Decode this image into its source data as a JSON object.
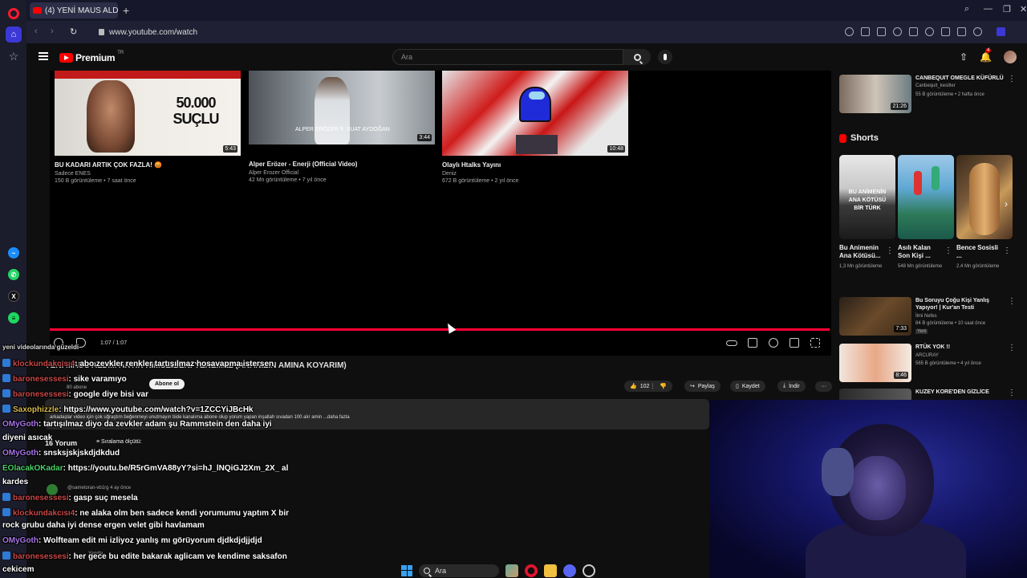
{
  "browser": {
    "tab_title": "(4) YENİ MAUS ALDIM AR",
    "new_tab": "+",
    "url": "www.youtube.com/watch",
    "window_controls": [
      "⌕",
      "—",
      "❐",
      "✕"
    ]
  },
  "header": {
    "logo_text": "Premium",
    "logo_region": "TR",
    "search_placeholder": "Ara"
  },
  "endscreen": [
    {
      "title": "BU KADARI ARTIK ÇOK FAZLA! 😡",
      "channel": "Sadece ENES",
      "meta": "150 B görüntüleme • 7 saat önce",
      "duration": "5:43",
      "thumb_text": "50.000 SUÇLU"
    },
    {
      "title": "Alper Erözer - Enerji (Official Video)",
      "channel": "Alper Erozer Official",
      "meta": "42 Mn görüntüleme • 7 yıl önce",
      "duration": "3:44",
      "thumb_text": "ALPER ERÖZER ft. SUAT AYDOĞAN"
    },
    {
      "title": "Olaylı Htalks Yayını",
      "channel": "Deniz",
      "meta": "672 B görüntüleme • 2 yıl önce",
      "duration": "10:48",
      "thumb_text": ""
    }
  ],
  "player": {
    "time": "1:07 / 1:07",
    "progress_fraction": 1.0
  },
  "video": {
    "title": "YENİ MAUS ALDIM ARTIK KIMSE BENİ YENEMEZ (ANANIZIN AMINA KOYARIM)",
    "subscribe": "Abone ol",
    "subs": "80 abone",
    "likes": "102",
    "share": "Paylaş",
    "save": "Kaydet",
    "download": "İndir",
    "more": "···",
    "description": "arkadaşlar video için çok uğraştım beğenmeyi unutmayın bide kanalıma abone olup yorum yapan inşallah sıvadan 100 alır amin ...daha fazla",
    "comment_count": "16 Yorum",
    "sort_label": "Sıralama ölçütü:",
    "comment_author": "@sametoran-vb1rg 4 ay önce",
    "comment_reply": "Yanıtla"
  },
  "chat": [
    {
      "user": "",
      "text": "yeni videolarında güzeldi",
      "color": "#ffffff"
    },
    {
      "user": "klockundakcısı4",
      "text": ": abo zevkler renkler tartışılmaz hosavapma istersen",
      "color": "#c84848"
    },
    {
      "user": "baronesessesi",
      "text": ": sike varamıyo",
      "color": "#c84848"
    },
    {
      "user": "baronesessesi",
      "text": ": google diye bisi var",
      "color": "#c84848"
    },
    {
      "user": "Saxophizzle",
      "text": ": https://www.youtube.com/watch?v=1ZCCYiJBcHk",
      "color": "#d6b84a"
    },
    {
      "user": "OMyGoth",
      "text": ": tartışılmaz diyo da zevkler adam şu Rammstein den daha iyi",
      "color": "#a874e8"
    },
    {
      "user": "",
      "text": "diyeni asıcak",
      "color": "#ffffff"
    },
    {
      "user": "OMyGoth",
      "text": ": snsksjskjskdjdkdud",
      "color": "#a874e8"
    },
    {
      "user": "EOlacakOKadar",
      "text": ": https://youtu.be/R5rGmVA88yY?si=hJ_lNQiGJ2Xm_2X_ al",
      "color": "#4fcf6a"
    },
    {
      "user": "",
      "text": "kardes",
      "color": "#ffffff"
    },
    {
      "user": "baronesessesi",
      "text": ": gasp suç mesela",
      "color": "#c84848"
    },
    {
      "user": "klockundakcısı4",
      "text": ": ne alaka olm ben sadece kendi yorumumu yaptım X bir",
      "color": "#c84848"
    },
    {
      "user": "",
      "text": "rock grubu daha iyi dense ergen velet gibi havlamam",
      "color": "#ffffff"
    },
    {
      "user": "OMyGoth",
      "text": ": Wolfteam edit mi izliyoz yanlış mı görüyorum djdkdjdjjdjd",
      "color": "#a874e8"
    },
    {
      "user": "baronesessesi",
      "text": ": her gece bu edite bakarak aglicam ve kendime saksafon",
      "color": "#c84848"
    },
    {
      "user": "",
      "text": "cekicem",
      "color": "#ffffff"
    }
  ],
  "sidebar": {
    "top_rec": {
      "title": "CANBEQUIT OMEGLE KÜFÜRLÜ",
      "channel": "Canbequit_kesitler",
      "meta": "55 B görüntüleme • 2 hafta önce",
      "duration": "21:26"
    },
    "shorts_heading": "Shorts",
    "shorts": [
      {
        "title": "Bu Animenin Ana Kötüsü...",
        "views": "1,3 Mn görüntüleme",
        "thumb_text": "BU ANİMENİN ANA KÖTÜSÜ BİR TÜRK"
      },
      {
        "title": "Asılı Kalan Son Kişi ...",
        "views": "548 Mn görüntüleme",
        "thumb_text": ""
      },
      {
        "title": "Bence Sosisli ...",
        "views": "2,4 Mn görüntüleme",
        "thumb_text": ""
      }
    ],
    "recs": [
      {
        "title": "Bu Soruyu Çoğu Kişi Yanlış Yapıyor! | Kur'an Testi",
        "channel": "İlmi Nefes",
        "meta": "84 B görüntüleme • 10 saat önce",
        "badge": "Yeni",
        "duration": "7:33"
      },
      {
        "title": "RTÜK YOK !!",
        "channel": "ARCURAY",
        "meta": "565 B görüntüleme • 4 yıl önce",
        "badge": "",
        "duration": "8:46"
      },
      {
        "title": "KUZEY KORE'DEN GİZLİCE",
        "channel": "",
        "meta": "",
        "badge": "",
        "duration": ""
      }
    ]
  },
  "taskbar": {
    "search": "Ara"
  }
}
